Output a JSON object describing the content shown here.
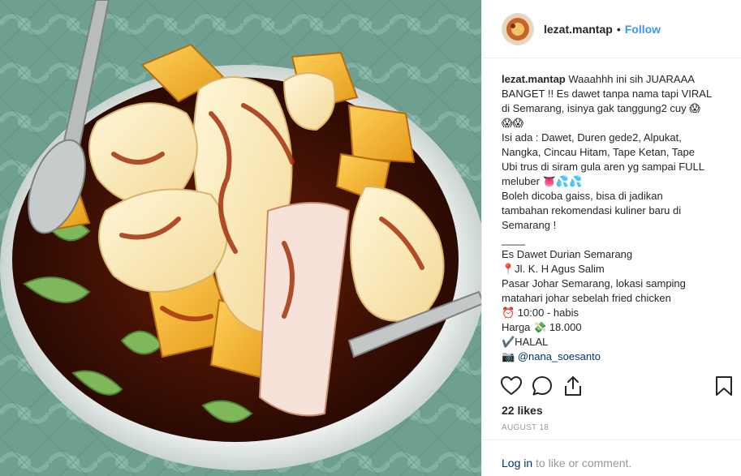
{
  "post": {
    "username": "lezat.mantap",
    "follow_label": "Follow",
    "dot": "•",
    "caption_lines": [
      " Waaahhh ini sih JUARAAA",
      "BANGET !! Es dawet tanpa nama tapi VIRAL",
      "di Semarang, isinya gak tanggung2 cuy 😱",
      "😱😱",
      "Isi ada : Dawet, Duren gede2, Alpukat,",
      "Nangka, Cincau Hitam, Tape Ketan, Tape",
      "Ubi trus di siram gula aren yg sampai FULL",
      "meluber 👅💦💦",
      "Boleh dicoba gaiss, bisa di jadikan",
      "tambahan rekomendasi kuliner baru di",
      "Semarang !",
      "____",
      "Es Dawet Durian Semarang",
      "📍Jl. K. H Agus Salim",
      "Pasar Johar Semarang, lokasi samping",
      "matahari johar sebelah fried chicken",
      "⏰ 10:00 - habis",
      "Harga 💸 18.000",
      "✔️HALAL",
      "📷 "
    ],
    "photo_credit": "@nana_soesanto",
    "likes": "22 likes",
    "date": "AUGUST 18"
  },
  "actions": {
    "like_icon": "heart-icon",
    "comment_icon": "comment-icon",
    "share_icon": "share-icon",
    "save_icon": "bookmark-icon"
  },
  "login": {
    "link_label": "Log in",
    "suffix": " to like or comment."
  },
  "colors": {
    "link_blue": "#3897f0",
    "mention_blue": "#003569",
    "muted_gray": "#999999",
    "border": "#efefef"
  }
}
